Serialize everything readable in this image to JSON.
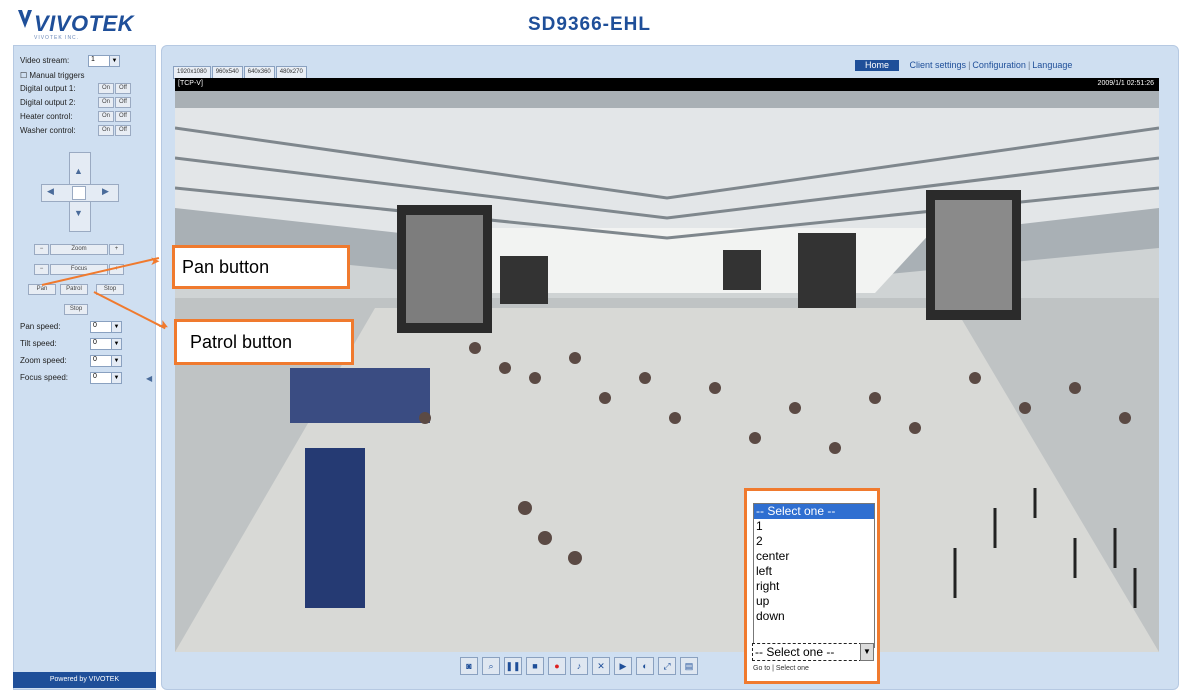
{
  "header": {
    "brand": "VIVOTEK",
    "brand_tagline": "VIVOTEK INC.",
    "model": "SD9366-EHL"
  },
  "left_panel": {
    "video_stream_label": "Video stream:",
    "video_stream_value": "1",
    "manual_triggers_label": "Manual triggers",
    "digital_output_1_label": "Digital output 1:",
    "digital_output_2_label": "Digital output 2:",
    "heater_control_label": "Heater control:",
    "washer_control_label": "Washer control:",
    "on_label": "On",
    "off_label": "Off",
    "zoom_label": "Zoom",
    "focus_label": "Focus",
    "pan_label": "Pan",
    "patrol_label": "Patrol",
    "stop_label": "Stop",
    "speeds": [
      {
        "label": "Pan speed:",
        "value": "0"
      },
      {
        "label": "Tilt speed:",
        "value": "0"
      },
      {
        "label": "Zoom speed:",
        "value": "0"
      },
      {
        "label": "Focus speed:",
        "value": "0"
      }
    ],
    "powered_by": "Powered by VIVOTEK"
  },
  "main": {
    "stream_tabs": [
      "1920x1080",
      "960x540",
      "640x360",
      "480x270"
    ],
    "nav": {
      "home": "Home",
      "client_settings": "Client settings",
      "configuration": "Configuration",
      "language": "Language"
    },
    "video_overlay_left": "[TCP-V]",
    "video_overlay_right": "2009/1/1 02:51:26"
  },
  "callouts": {
    "pan_button": "Pan button",
    "patrol_button": "Patrol button"
  },
  "dropdown": {
    "options": [
      "-- Select one --",
      "1",
      "2",
      "center",
      "left",
      "right",
      "up",
      "down"
    ],
    "selected": "-- Select one --",
    "footer": "Go to | Select one"
  },
  "colors": {
    "panel_bg": "#cfdff1",
    "brand_blue": "#1f4f99",
    "callout_orange": "#f07a2e",
    "highlight_blue": "#2f6fd1"
  }
}
